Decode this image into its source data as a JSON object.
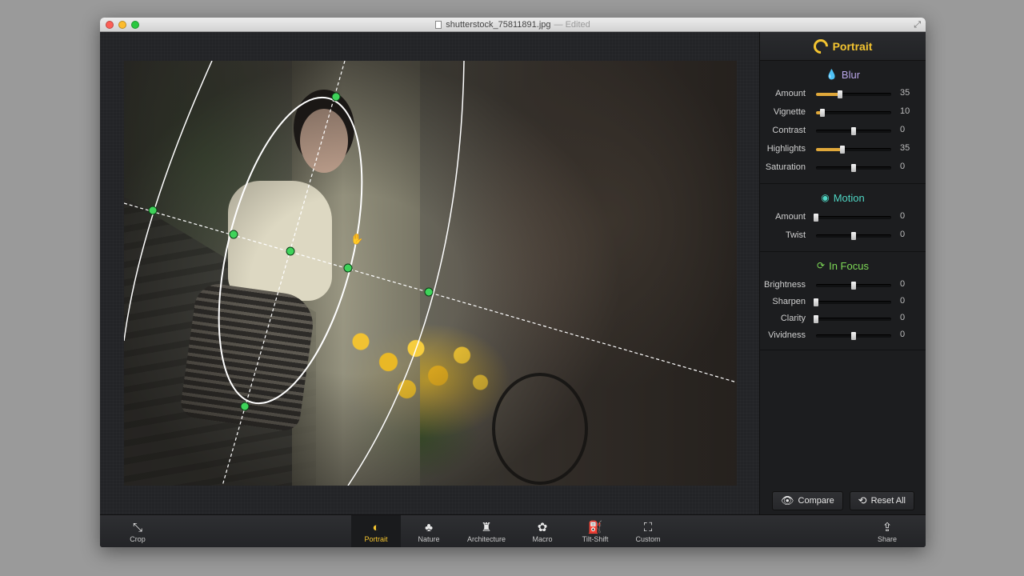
{
  "window": {
    "filename": "shutterstock_75811891.jpg",
    "status": "— Edited"
  },
  "sidebar": {
    "mode_title": "Portrait",
    "blur": {
      "title": "Blur",
      "rows": [
        {
          "label": "Amount",
          "value": "35",
          "level": 0.32,
          "filled": true
        },
        {
          "label": "Vignette",
          "value": "10",
          "level": 0.09,
          "filled": true
        },
        {
          "label": "Contrast",
          "value": "0",
          "level": 0.5,
          "filled": false
        },
        {
          "label": "Highlights",
          "value": "35",
          "level": 0.35,
          "filled": true
        },
        {
          "label": "Saturation",
          "value": "0",
          "level": 0.5,
          "filled": false
        }
      ]
    },
    "motion": {
      "title": "Motion",
      "rows": [
        {
          "label": "Amount",
          "value": "0",
          "level": 0.0,
          "filled": false
        },
        {
          "label": "Twist",
          "value": "0",
          "level": 0.5,
          "filled": false
        }
      ]
    },
    "in_focus": {
      "title": "In Focus",
      "rows": [
        {
          "label": "Brightness",
          "value": "0",
          "level": 0.5,
          "filled": false
        },
        {
          "label": "Sharpen",
          "value": "0",
          "level": 0.0,
          "filled": false
        },
        {
          "label": "Clarity",
          "value": "0",
          "level": 0.0,
          "filled": false
        },
        {
          "label": "Vividness",
          "value": "0",
          "level": 0.5,
          "filled": false
        }
      ]
    },
    "compare_label": "Compare",
    "reset_label": "Reset All"
  },
  "toolbar": {
    "crop": "Crop",
    "portrait": "Portrait",
    "nature": "Nature",
    "architecture": "Architecture",
    "macro": "Macro",
    "tilt_shift": "Tilt-Shift",
    "custom": "Custom",
    "share": "Share"
  },
  "colors": {
    "accent": "#f4c430",
    "blur": "#b9a6e8",
    "motion": "#4fd6c4",
    "focus": "#7ed957",
    "handle": "#3fd35a"
  }
}
